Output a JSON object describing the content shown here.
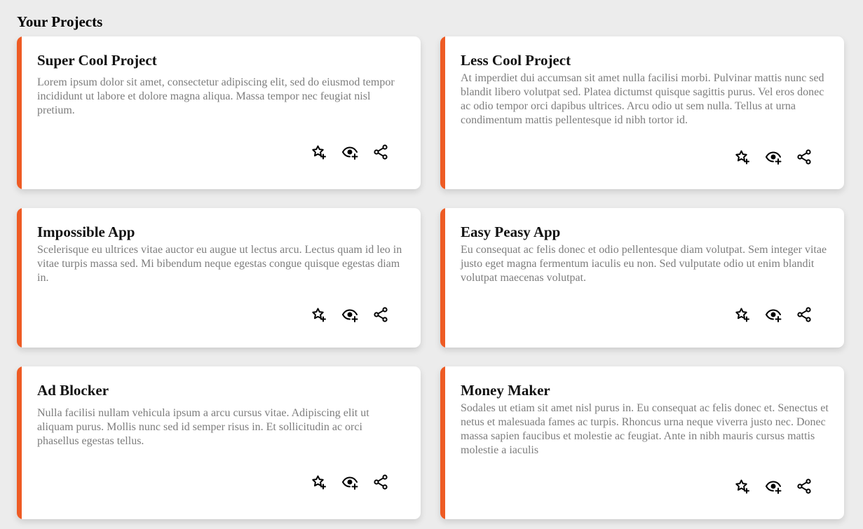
{
  "page": {
    "title": "Your Projects"
  },
  "colors": {
    "accent": "#ee5b24",
    "background": "#ececec",
    "card": "#ffffff",
    "description": "#7d7d7d"
  },
  "actions": {
    "favorite_icon": "star-plus-icon",
    "watch_icon": "eye-plus-icon",
    "share_icon": "share-icon"
  },
  "projects": [
    {
      "title": "Super Cool Project",
      "description": "Lorem ipsum dolor sit amet, consectetur adipiscing elit, sed do eiusmod tempor incididunt ut labore et dolore magna aliqua. Massa tempor nec feugiat nisl pretium."
    },
    {
      "title": "Less Cool Project",
      "description": "At imperdiet dui accumsan sit amet nulla facilisi morbi. Pulvinar mattis nunc sed blandit libero volutpat sed. Platea dictumst quisque sagittis purus. Vel eros donec ac odio tempor orci dapibus ultrices. Arcu odio ut sem nulla. Tellus at urna condimentum mattis pellentesque id nibh tortor id."
    },
    {
      "title": "Impossible App",
      "description": "Scelerisque eu ultrices vitae auctor eu augue ut lectus arcu. Lectus quam id leo in vitae turpis massa sed. Mi bibendum neque egestas congue quisque egestas diam in."
    },
    {
      "title": "Easy Peasy App",
      "description": "Eu consequat ac felis donec et odio pellentesque diam volutpat. Sem integer vitae justo eget magna fermentum iaculis eu non. Sed vulputate odio ut enim blandit volutpat maecenas volutpat."
    },
    {
      "title": "Ad Blocker",
      "description": "Nulla facilisi nullam vehicula ipsum a arcu cursus vitae. Adipiscing elit ut aliquam purus. Mollis nunc sed id semper risus in. Et sollicitudin ac orci phasellus egestas tellus."
    },
    {
      "title": "Money Maker",
      "description": "Sodales ut etiam sit amet nisl purus in. Eu consequat ac felis donec et. Senectus et netus et malesuada fames ac turpis. Rhoncus urna neque viverra justo nec. Donec massa sapien faucibus et molestie ac feugiat. Ante in nibh mauris cursus mattis molestie a iaculis"
    }
  ]
}
